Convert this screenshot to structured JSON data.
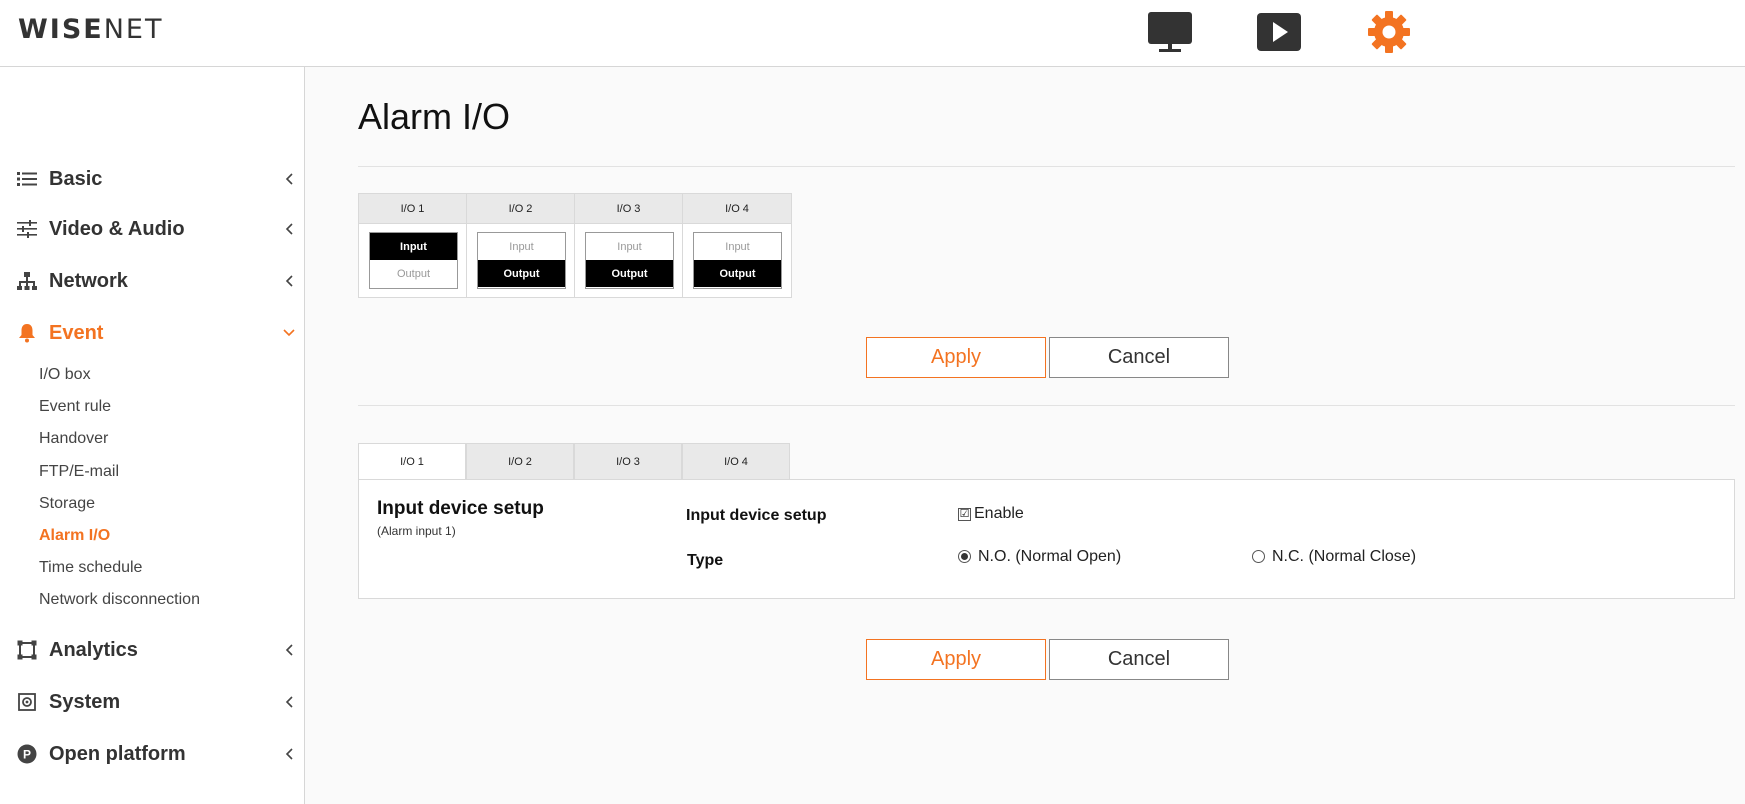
{
  "header": {
    "logo_bold": "WISE",
    "logo_light": "NET",
    "icons": [
      "monitor-icon",
      "play-icon",
      "gear-icon"
    ],
    "accent_color": "#f37321"
  },
  "sidebar": {
    "items": [
      {
        "label": "Basic",
        "icon": "list-icon"
      },
      {
        "label": "Video & Audio",
        "icon": "sliders-icon"
      },
      {
        "label": "Network",
        "icon": "network-icon"
      },
      {
        "label": "Event",
        "icon": "bell-icon",
        "expanded": true
      },
      {
        "label": "Analytics",
        "icon": "crop-icon"
      },
      {
        "label": "System",
        "icon": "system-icon"
      },
      {
        "label": "Open platform",
        "icon": "platform-icon"
      }
    ],
    "event_subitems": [
      "I/O box",
      "Event rule",
      "Handover",
      "FTP/E-mail",
      "Storage",
      "Alarm I/O",
      "Time schedule",
      "Network disconnection"
    ],
    "active_subitem": "Alarm I/O"
  },
  "main": {
    "title": "Alarm I/O",
    "io_overview": {
      "columns": [
        {
          "label": "I/O 1",
          "input": "Input",
          "output": "Output",
          "selected": "Input"
        },
        {
          "label": "I/O 2",
          "input": "Input",
          "output": "Output",
          "selected": "Output"
        },
        {
          "label": "I/O 3",
          "input": "Input",
          "output": "Output",
          "selected": "Output"
        },
        {
          "label": "I/O 4",
          "input": "Input",
          "output": "Output",
          "selected": "Output"
        }
      ]
    },
    "buttons": {
      "apply": "Apply",
      "cancel": "Cancel"
    },
    "tabs": [
      "I/O 1",
      "I/O 2",
      "I/O 3",
      "I/O 4"
    ],
    "active_tab": "I/O 1",
    "panel": {
      "title": "Input device setup",
      "subtitle": "(Alarm input 1)",
      "field1_label": "Input device setup",
      "enable_label": "Enable",
      "enable_checked": true,
      "field2_label": "Type",
      "type_options": [
        "N.O. (Normal Open)",
        "N.C. (Normal Close)"
      ],
      "type_selected": "N.O. (Normal Open)"
    }
  }
}
